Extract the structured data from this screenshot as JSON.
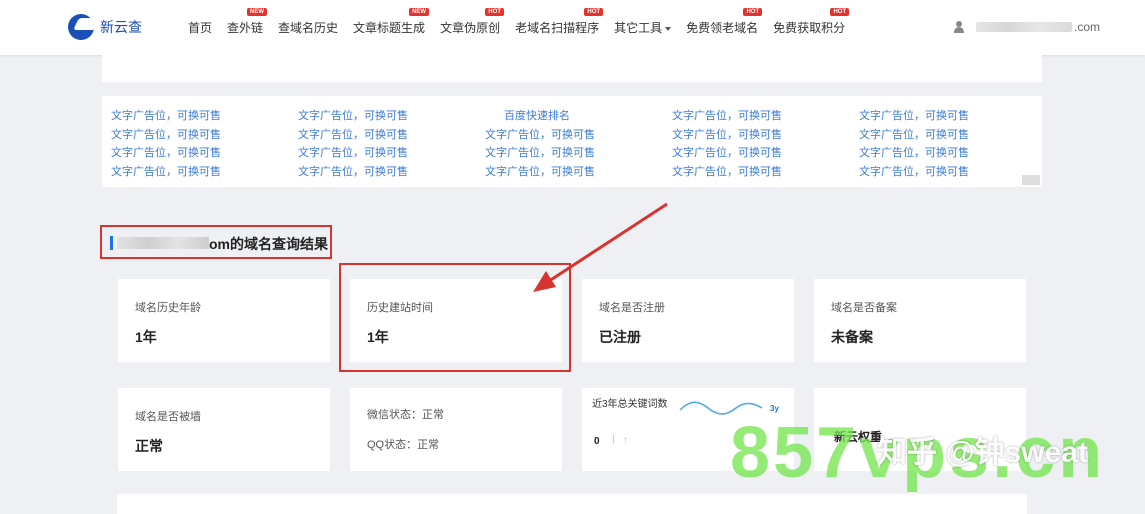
{
  "header": {
    "logo_text": "新云查",
    "nav": [
      {
        "label": "首页",
        "badge": ""
      },
      {
        "label": "查外链",
        "badge": "NEW"
      },
      {
        "label": "查域名历史",
        "badge": ""
      },
      {
        "label": "文章标题生成",
        "badge": "NEW"
      },
      {
        "label": "文章伪原创",
        "badge": "HOT"
      },
      {
        "label": "老域名扫描程序",
        "badge": "HOT"
      },
      {
        "label": "其它工具",
        "badge": ""
      },
      {
        "label": "免费领老域名",
        "badge": "HOT"
      },
      {
        "label": "免费获取积分",
        "badge": "HOT"
      }
    ],
    "user_suffix": ".com"
  },
  "ads": {
    "col1": [
      "文字广告位，可换可售",
      "文字广告位，可换可售",
      "文字广告位，可换可售",
      "文字广告位，可换可售"
    ],
    "col2": [
      "文字广告位，可换可售",
      "文字广告位，可换可售",
      "文字广告位，可换可售",
      "文字广告位，可换可售"
    ],
    "col3": [
      "百度快速排名",
      "文字广告位，可换可售",
      "文字广告位，可换可售",
      "文字广告位，可换可售"
    ],
    "col4": [
      "文字广告位，可换可售",
      "文字广告位，可换可售",
      "文字广告位，可换可售",
      "文字广告位，可换可售"
    ],
    "col5": [
      "文字广告位，可换可售",
      "文字广告位，可换可售",
      "文字广告位，可换可售",
      "文字广告位，可换可售"
    ]
  },
  "result_title": "om的域名查询结果",
  "cards": {
    "history_age": {
      "label": "域名历史年龄",
      "value": "1年"
    },
    "build_time": {
      "label": "历史建站时间",
      "value": "1年"
    },
    "registered": {
      "label": "域名是否注册",
      "value": "已注册"
    },
    "icp": {
      "label": "域名是否备案",
      "value": "未备案"
    },
    "blocked": {
      "label": "域名是否被墙",
      "value": "正常"
    },
    "wechat_status": "微信状态：正常",
    "qq_status": "QQ状态：正常",
    "keywords": {
      "label": "近3年总关键词数",
      "period": "3y",
      "count": "0",
      "sep": "|",
      "arrow": "↑"
    },
    "weight": {
      "label": "新云权重"
    }
  },
  "watermarks": {
    "zhihu": "知乎 @钟sweat",
    "site": "857vps.cn"
  },
  "colors": {
    "accent": "#1a4fb8",
    "link": "#3d7bd9",
    "highlight_red": "#d8332e",
    "watermark_green": "#76e650"
  }
}
